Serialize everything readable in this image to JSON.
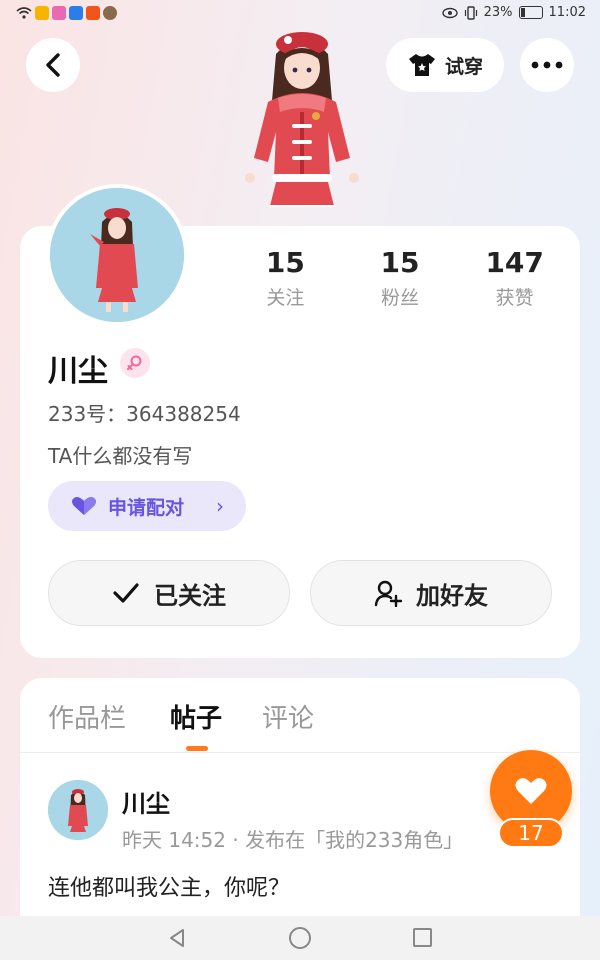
{
  "status_bar": {
    "battery": "23%",
    "time": "11:02"
  },
  "header": {
    "try_on_label": "试穿"
  },
  "profile": {
    "stats": [
      {
        "value": "15",
        "label": "关注"
      },
      {
        "value": "15",
        "label": "粉丝"
      },
      {
        "value": "147",
        "label": "获赞"
      }
    ],
    "name": "川尘",
    "gender": "female",
    "id_line": "233号：364388254",
    "bio": "TA什么都没有写",
    "match_label": "申请配对",
    "followed_label": "已关注",
    "add_friend_label": "加好友"
  },
  "tabs": [
    {
      "label": "作品栏",
      "active": false
    },
    {
      "label": "帖子",
      "active": true
    },
    {
      "label": "评论",
      "active": false
    }
  ],
  "post": {
    "author": "川尘",
    "meta": "昨天 14:52 · 发布在「我的233角色」",
    "text": "连他都叫我公主，你呢？"
  },
  "like": {
    "count": "17"
  },
  "colors": {
    "accent": "#ff7a12",
    "match": "#6754e0",
    "card": "#ffffff"
  }
}
